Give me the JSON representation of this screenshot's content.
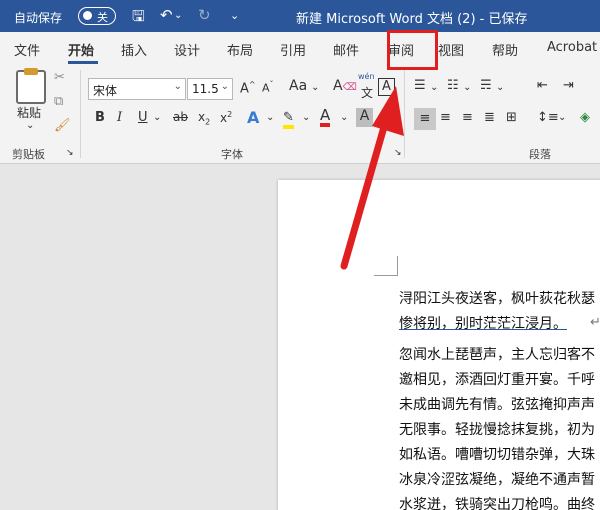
{
  "titlebar": {
    "autosave_label": "自动保存",
    "autosave_state": "关",
    "doc_title": "新建 Microsoft Word 文档 (2) - 已保存"
  },
  "tabs": [
    "文件",
    "开始",
    "插入",
    "设计",
    "布局",
    "引用",
    "邮件",
    "审阅",
    "视图",
    "帮助",
    "Acrobat"
  ],
  "active_tab": "开始",
  "ribbon": {
    "clipboard": {
      "paste_label": "粘贴",
      "group_label": "剪贴板"
    },
    "font": {
      "font_name": "宋体",
      "font_size": "11.5",
      "group_label": "字体",
      "phonetic_top": "wén",
      "phonetic_char": "文"
    },
    "paragraph": {
      "group_label": "段落"
    }
  },
  "document": {
    "lines": [
      "浔阳江头夜送客，枫叶荻花秋瑟",
      "惨将别，别时茫茫江浸月。",
      "忽闻水上琵琶声，主人忘归客不",
      "邀相见，添酒回灯重开宴。千呼",
      "未成曲调先有情。弦弦掩抑声声",
      "无限事。轻拢慢捻抹复挑，初为",
      "如私语。嘈嘈切切错杂弹，大珠",
      "冰泉冷涩弦凝绝，凝绝不通声暂",
      "水浆迸，铁骑突出刀枪鸣。曲终"
    ],
    "paragraph_mark": "↵"
  },
  "colors": {
    "title_bar": "#2b579a",
    "annotation": "#e02020"
  }
}
